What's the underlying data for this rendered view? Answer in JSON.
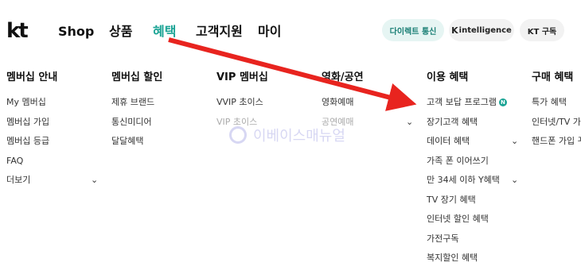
{
  "header": {
    "logo": "kt",
    "nav": [
      "Shop",
      "상품",
      "혜택",
      "고객지원",
      "마이"
    ],
    "active_nav": "혜택",
    "pills": {
      "direct": "다이렉트 통신",
      "kintel_mark": "K",
      "kintel": "intelligence",
      "ktsub": "KT 구독"
    }
  },
  "menu": {
    "columns": [
      {
        "title": "멤버십 안내",
        "items": [
          "My 멤버십",
          "멤버십 가입",
          "멤버십 등급",
          "FAQ",
          "더보기"
        ]
      },
      {
        "title": "멤버십 할인",
        "items": [
          "제휴 브랜드",
          "통신미디어",
          "달달혜택"
        ]
      },
      {
        "title": "VIP 멤버십",
        "items": [
          "VVIP 초이스",
          "VIP 초이스"
        ]
      },
      {
        "title": "영화/공연",
        "items": [
          "영화예매",
          "공연예매"
        ]
      },
      {
        "title": "이용 혜택",
        "items": [
          "고객 보답 프로그램",
          "장기고객 혜택",
          "데이터 혜택",
          "가족 폰 이어쓰기",
          "만 34세 이하 Y혜택",
          "TV 장기 혜택",
          "인터넷 할인 혜택",
          "가전구독",
          "복지할인 혜택"
        ],
        "new_badge": "N"
      },
      {
        "title": "구매 혜택",
        "items": [
          "특가 혜택",
          "인터넷/TV 가입",
          "핸드폰 가입 꾸러미"
        ]
      }
    ]
  },
  "watermark": "이베이스매뉴얼",
  "colors": {
    "accent": "#1aa394",
    "arrow": "#e8241f"
  }
}
